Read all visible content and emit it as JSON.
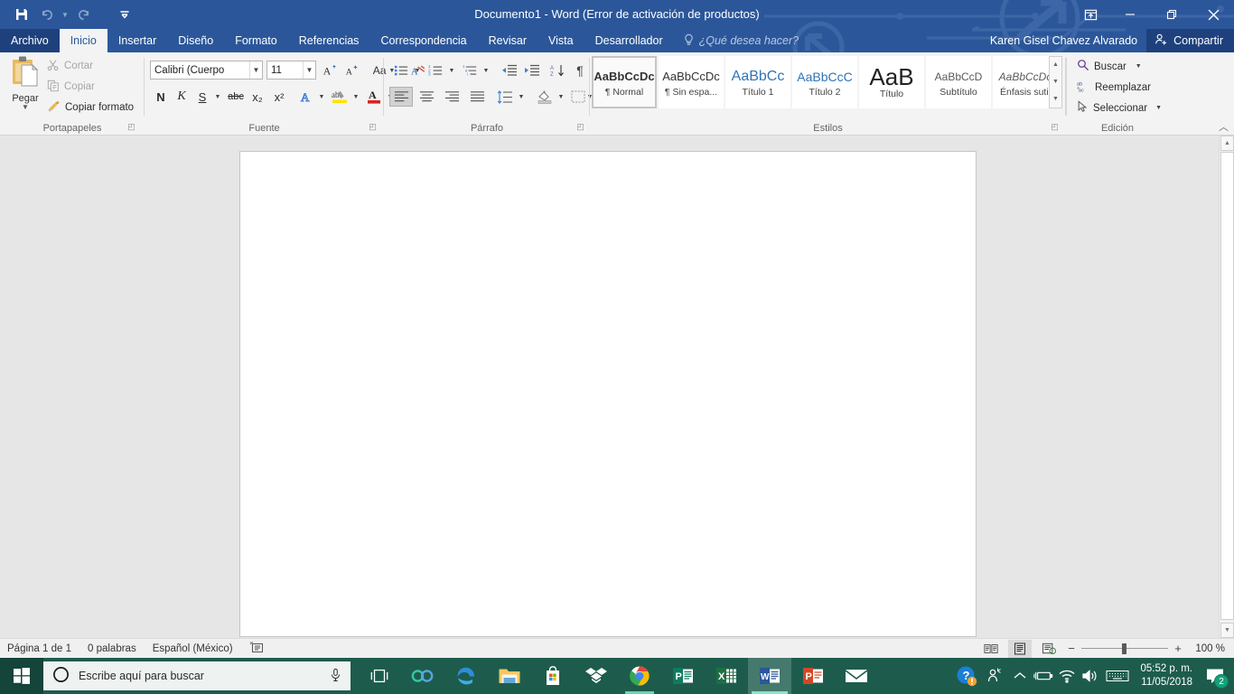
{
  "window": {
    "title": "Documento1 - Word (Error de activación de productos)",
    "theme_color": "#2b579a",
    "quick_access": [
      {
        "name": "save",
        "icon": "save-icon",
        "enabled": true
      },
      {
        "name": "undo",
        "icon": "undo-icon",
        "enabled": false
      },
      {
        "name": "redo",
        "icon": "redo-icon",
        "enabled": false
      },
      {
        "name": "customize",
        "icon": "customize-qat-icon",
        "enabled": true
      }
    ],
    "controls": {
      "ribbon_display": "Opciones de presentación de la cinta de opciones",
      "minimize": "Minimizar",
      "restore": "Restaurar",
      "close": "Cerrar"
    }
  },
  "tabs": [
    {
      "label": "Archivo",
      "active": false,
      "file": true
    },
    {
      "label": "Inicio",
      "active": true,
      "file": false
    },
    {
      "label": "Insertar",
      "active": false,
      "file": false
    },
    {
      "label": "Diseño",
      "active": false,
      "file": false
    },
    {
      "label": "Formato",
      "active": false,
      "file": false
    },
    {
      "label": "Referencias",
      "active": false,
      "file": false
    },
    {
      "label": "Correspondencia",
      "active": false,
      "file": false
    },
    {
      "label": "Revisar",
      "active": false,
      "file": false
    },
    {
      "label": "Vista",
      "active": false,
      "file": false
    },
    {
      "label": "Desarrollador",
      "active": false,
      "file": false
    }
  ],
  "tellme": {
    "label": "¿Qué desea hacer?",
    "icon": "lightbulb-icon"
  },
  "account": {
    "user": "Karen Gisel Chavez Alvarado",
    "share_label": "Compartir",
    "share_icon": "person-add-icon"
  },
  "ribbon": {
    "clipboard": {
      "group_label": "Portapapeles",
      "paste_label": "Pegar",
      "items": [
        {
          "label": "Cortar",
          "icon": "scissors-icon",
          "enabled": false
        },
        {
          "label": "Copiar",
          "icon": "copy-icon",
          "enabled": false
        },
        {
          "label": "Copiar formato",
          "icon": "format-painter-icon",
          "enabled": true
        }
      ]
    },
    "font": {
      "group_label": "Fuente",
      "font_name": "Calibri (Cuerpo",
      "font_size": "11",
      "buttons_row1": [
        {
          "name": "grow-font-icon",
          "label": "A"
        },
        {
          "name": "shrink-font-icon",
          "label": "A"
        },
        {
          "name": "change-case-icon",
          "label": "Aa"
        },
        {
          "name": "clear-formatting-icon",
          "label": "A"
        }
      ],
      "buttons_row2": [
        {
          "name": "bold-button",
          "label": "N"
        },
        {
          "name": "italic-button",
          "label": "K"
        },
        {
          "name": "underline-button",
          "label": "S"
        },
        {
          "name": "strikethrough-button",
          "label": "abc"
        },
        {
          "name": "subscript-button",
          "label": "x₂"
        },
        {
          "name": "superscript-button",
          "label": "x²"
        },
        {
          "name": "text-effects-button",
          "label": "A"
        },
        {
          "name": "highlight-button",
          "label": "ab"
        },
        {
          "name": "font-color-button",
          "label": "A"
        }
      ]
    },
    "paragraph": {
      "group_label": "Párrafo",
      "row1": [
        {
          "name": "bullets-button"
        },
        {
          "name": "numbering-button"
        },
        {
          "name": "multilevel-list-button"
        },
        {
          "name": "decrease-indent-button"
        },
        {
          "name": "increase-indent-button"
        },
        {
          "name": "sort-button"
        },
        {
          "name": "show-marks-button"
        }
      ],
      "row2": [
        {
          "name": "align-left-button",
          "active": true
        },
        {
          "name": "align-center-button",
          "active": false
        },
        {
          "name": "align-right-button",
          "active": false
        },
        {
          "name": "justify-button",
          "active": false
        },
        {
          "name": "line-spacing-button",
          "active": false
        },
        {
          "name": "shading-button",
          "active": false
        },
        {
          "name": "borders-button",
          "active": false
        }
      ]
    },
    "styles": {
      "group_label": "Estilos",
      "items": [
        {
          "sample": "AaBbCcDc",
          "name": "¶ Normal",
          "selected": true,
          "style": "normal"
        },
        {
          "sample": "AaBbCcDc",
          "name": "¶ Sin espa...",
          "selected": false,
          "style": "normal"
        },
        {
          "sample": "AaBbCc",
          "name": "Título 1",
          "selected": false,
          "style": "heading1"
        },
        {
          "sample": "AaBbCcC",
          "name": "Título 2",
          "selected": false,
          "style": "heading2"
        },
        {
          "sample": "AaB",
          "name": "Título",
          "selected": false,
          "style": "title"
        },
        {
          "sample": "AaBbCcD",
          "name": "Subtítulo",
          "selected": false,
          "style": "subtitle"
        },
        {
          "sample": "AaBbCcDc",
          "name": "Énfasis sutil",
          "selected": false,
          "style": "emphasis"
        }
      ]
    },
    "editing": {
      "group_label": "Edición",
      "items": [
        {
          "label": "Buscar",
          "icon": "search-icon",
          "caret": true
        },
        {
          "label": "Reemplazar",
          "icon": "replace-icon",
          "caret": false
        },
        {
          "label": "Seleccionar",
          "icon": "select-icon",
          "caret": true
        }
      ]
    }
  },
  "document": {
    "content": ""
  },
  "statusbar": {
    "page": "Página 1 de 1",
    "words": "0 palabras",
    "language": "Español (México)",
    "proofing_icon": "proofing-icon",
    "views": [
      {
        "name": "read-mode-view",
        "active": false
      },
      {
        "name": "print-layout-view",
        "active": true
      },
      {
        "name": "web-layout-view",
        "active": false
      }
    ],
    "zoom_out": "−",
    "zoom_in": "+",
    "zoom_level": "100 %"
  },
  "taskbar": {
    "start_icon": "windows-start-icon",
    "search_placeholder": "Escribe aquí para buscar",
    "search_icon": "cortana-circle-icon",
    "mic_icon": "microphone-icon",
    "pinned": [
      {
        "name": "task-view-icon",
        "running": false,
        "active": false
      },
      {
        "name": "cortana-infinity-icon",
        "running": false,
        "active": false
      },
      {
        "name": "edge-icon",
        "running": false,
        "active": false
      },
      {
        "name": "file-explorer-icon",
        "running": false,
        "active": false
      },
      {
        "name": "microsoft-store-icon",
        "running": false,
        "active": false
      },
      {
        "name": "dropbox-icon",
        "running": false,
        "active": false
      },
      {
        "name": "chrome-icon",
        "running": true,
        "active": false
      },
      {
        "name": "publisher-icon",
        "running": false,
        "active": false
      },
      {
        "name": "excel-icon",
        "running": false,
        "active": false
      },
      {
        "name": "word-icon",
        "running": false,
        "active": true
      },
      {
        "name": "powerpoint-icon",
        "running": false,
        "active": false
      },
      {
        "name": "mail-icon",
        "running": false,
        "active": false
      }
    ],
    "tray": [
      {
        "name": "help-support-icon"
      },
      {
        "name": "people-icon"
      },
      {
        "name": "show-hidden-icons-icon"
      },
      {
        "name": "battery-icon"
      },
      {
        "name": "wifi-icon"
      },
      {
        "name": "volume-icon"
      },
      {
        "name": "keyboard-icon"
      }
    ],
    "time": "05:52 p. m.",
    "date": "11/05/2018",
    "notifications_icon": "action-center-icon",
    "notifications_count": "2"
  },
  "colors": {
    "word_blue": "#2b579a",
    "word_dark_blue": "#1e417d",
    "taskbar_green": "#1d5c4d",
    "ribbon_bg": "#f3f3f3",
    "doc_bg": "#e6e6e6"
  }
}
